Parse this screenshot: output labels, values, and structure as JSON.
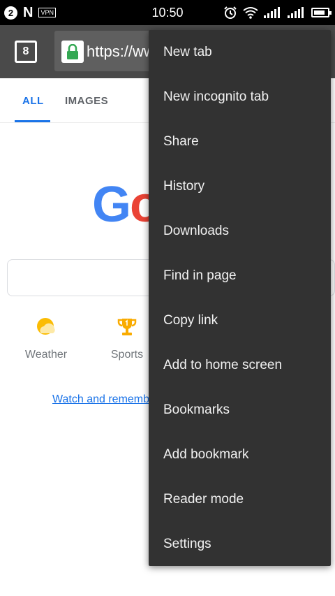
{
  "status_bar": {
    "notification_count": "2",
    "n_logo": "N",
    "vpn": "VPN",
    "time": "10:50",
    "icons": [
      "alarm-icon",
      "wifi-icon",
      "signal-icon",
      "signal-icon",
      "battery-icon"
    ],
    "battery_level": 0.85
  },
  "toolbar": {
    "tab_count": "8",
    "url": "https://www.google.com",
    "lock_icon": "lock-icon",
    "lock_color": "#34a853"
  },
  "search_tabs": {
    "all": "ALL",
    "images": "IMAGES",
    "accent": "#1a73e8"
  },
  "logo": {
    "text": "Google",
    "visible_g": "G",
    "visible_o": "o",
    "colors": [
      "#4285f4",
      "#ea4335"
    ]
  },
  "shortcuts": [
    {
      "label": "Weather",
      "icon": "weather-sun-cloud-icon"
    },
    {
      "label": "Sports",
      "icon": "trophy-icon"
    }
  ],
  "promo_link": "Watch and remember",
  "menu": {
    "background": "#323232",
    "items": [
      "New tab",
      "New incognito tab",
      "Share",
      "History",
      "Downloads",
      "Find in page",
      "Copy link",
      "Add to home screen",
      "Bookmarks",
      "Add bookmark",
      "Reader mode",
      "Settings"
    ]
  }
}
